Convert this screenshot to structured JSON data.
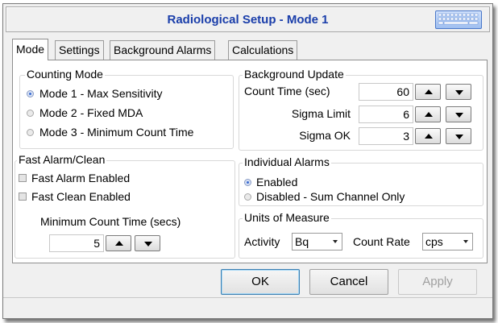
{
  "window": {
    "title": "Radiological Setup - Mode 1",
    "title_color": "#1a3eaa"
  },
  "titlebar_icon": "keyboard-icon",
  "tabs": [
    {
      "label": "Mode",
      "active": true
    },
    {
      "label": "Settings",
      "active": false
    },
    {
      "label": "Background Alarms",
      "active": false
    },
    {
      "label": "Calculations",
      "active": false
    }
  ],
  "counting_mode": {
    "label": "Counting Mode",
    "options": [
      {
        "label": "Mode 1 - Max Sensitivity",
        "checked": true
      },
      {
        "label": "Mode 2 - Fixed MDA",
        "checked": false
      },
      {
        "label": "Mode 3 - Minimum Count Time",
        "checked": false
      }
    ]
  },
  "fast_alarm": {
    "label": "Fast Alarm/Clean",
    "options": [
      {
        "label": "Fast Alarm Enabled",
        "checked": false
      },
      {
        "label": "Fast Clean Enabled",
        "checked": false
      }
    ],
    "min_count_label": "Minimum Count Time (secs)",
    "min_count_value": "5"
  },
  "background_update": {
    "label": "Background Update",
    "count_time_label": "Count Time (sec)",
    "count_time_value": "60",
    "sigma_limit_label": "Sigma Limit",
    "sigma_limit_value": "6",
    "sigma_ok_label": "Sigma OK",
    "sigma_ok_value": "3"
  },
  "individual_alarms": {
    "label": "Individual Alarms",
    "options": [
      {
        "label": "Enabled",
        "checked": true
      },
      {
        "label": "Disabled - Sum Channel Only",
        "checked": false
      }
    ]
  },
  "units": {
    "label": "Units of Measure",
    "activity_label": "Activity",
    "activity_value": "Bq",
    "count_rate_label": "Count Rate",
    "count_rate_value": "cps"
  },
  "buttons": {
    "ok": "OK",
    "cancel": "Cancel",
    "apply": "Apply"
  }
}
